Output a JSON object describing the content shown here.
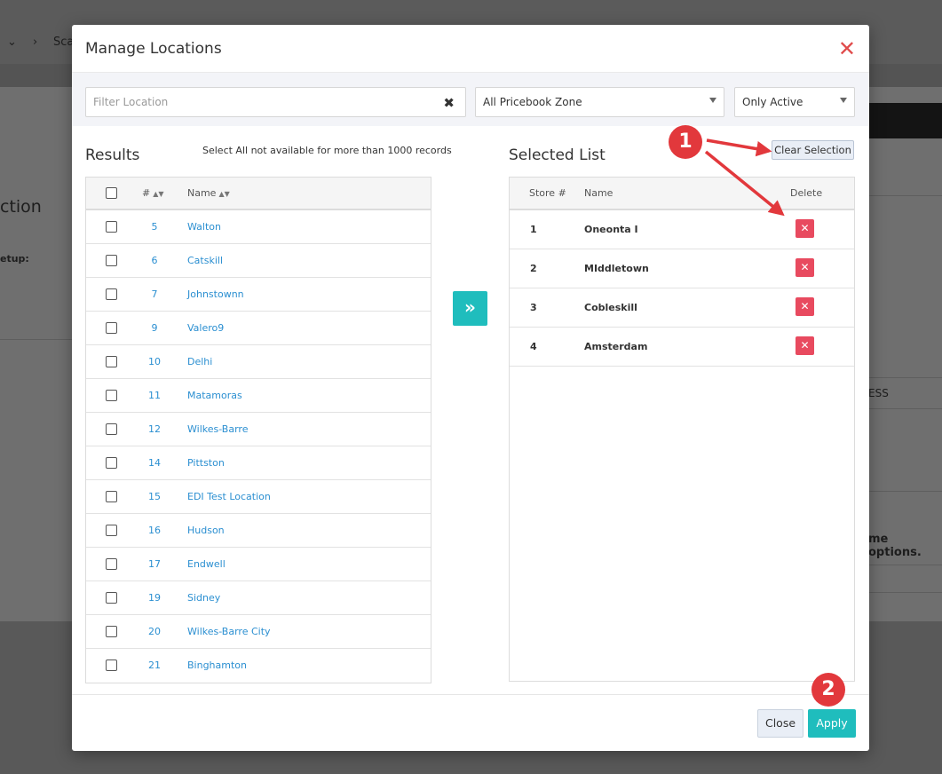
{
  "background": {
    "breadcrumb_text": "Sca",
    "section_title": "ction",
    "setup_label": "etup:",
    "right_text_1": "ESS",
    "right_text_2": "me options."
  },
  "modal": {
    "title": "Manage Locations",
    "filter": {
      "placeholder": "Filter Location",
      "value": "",
      "zone_select": "All Pricebook Zone",
      "status_select": "Only Active"
    },
    "results": {
      "title": "Results",
      "note": "Select All not available for more than 1000 records",
      "columns": {
        "number": "#",
        "name": "Name"
      },
      "rows": [
        {
          "num": "5",
          "name": "Walton"
        },
        {
          "num": "6",
          "name": "Catskill"
        },
        {
          "num": "7",
          "name": "Johnstownn"
        },
        {
          "num": "9",
          "name": "Valero9"
        },
        {
          "num": "10",
          "name": "Delhi"
        },
        {
          "num": "11",
          "name": "Matamoras"
        },
        {
          "num": "12",
          "name": "Wilkes-Barre"
        },
        {
          "num": "14",
          "name": "Pittston"
        },
        {
          "num": "15",
          "name": "EDI Test Location"
        },
        {
          "num": "16",
          "name": "Hudson"
        },
        {
          "num": "17",
          "name": "Endwell"
        },
        {
          "num": "19",
          "name": "Sidney"
        },
        {
          "num": "20",
          "name": "Wilkes-Barre City"
        },
        {
          "num": "21",
          "name": "Binghamton"
        }
      ]
    },
    "move_button_glyph": "»",
    "selected": {
      "title": "Selected List",
      "clear_button": "Clear Selection",
      "columns": {
        "store": "Store #",
        "name": "Name",
        "delete": "Delete"
      },
      "rows": [
        {
          "store": "1",
          "name": "Oneonta I"
        },
        {
          "store": "2",
          "name": "MIddletown"
        },
        {
          "store": "3",
          "name": "Cobleskill"
        },
        {
          "store": "4",
          "name": "Amsterdam"
        }
      ]
    },
    "footer": {
      "close": "Close",
      "apply": "Apply"
    }
  },
  "annotations": {
    "badge_1": "1",
    "badge_2": "2"
  },
  "colors": {
    "accent": "#1fbdbd",
    "danger": "#e84a5f",
    "annotation": "#e2383c",
    "link": "#2b8fd1"
  }
}
